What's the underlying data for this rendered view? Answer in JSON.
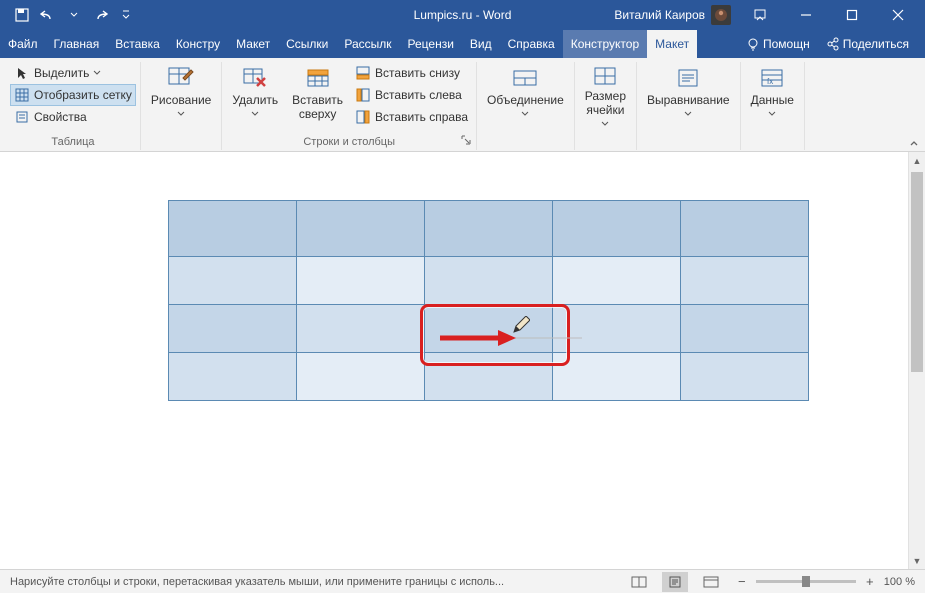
{
  "titlebar": {
    "title": "Lumpics.ru - Word",
    "user": "Виталий Каиров"
  },
  "tabs": {
    "file": "Файл",
    "home": "Главная",
    "insert": "Вставка",
    "design": "Констру",
    "layout": "Макет",
    "references": "Ссылки",
    "mailings": "Рассылк",
    "review": "Рецензи",
    "view": "Вид",
    "help": "Справка",
    "table_design": "Конструктор",
    "table_layout": "Макет",
    "tell_me": "Помощн",
    "share": "Поделиться"
  },
  "ribbon": {
    "table_group": {
      "label": "Таблица",
      "select": "Выделить",
      "gridlines": "Отобразить сетку",
      "properties": "Свойства"
    },
    "draw_group": {
      "draw": "Рисование"
    },
    "delete": "Удалить",
    "insert_above": "Вставить\nсверху",
    "insert_below": "Вставить снизу",
    "insert_left": "Вставить слева",
    "insert_right": "Вставить справа",
    "rows_cols_label": "Строки и столбцы",
    "merge": "Объединение",
    "cell_size": "Размер\nячейки",
    "alignment": "Выравнивание",
    "data": "Данные"
  },
  "status": {
    "text": "Нарисуйте столбцы и строки, перетаскивая указатель мыши, или примените границы с исполь...",
    "zoom": "100 %"
  }
}
